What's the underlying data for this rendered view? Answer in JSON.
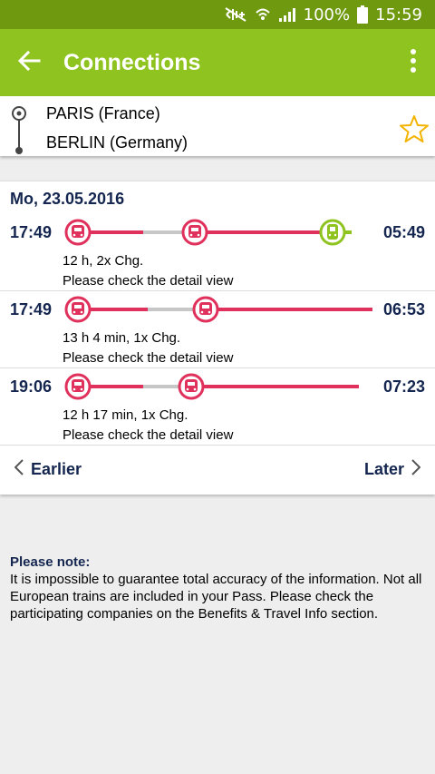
{
  "status_bar": {
    "battery": "100%",
    "time": "15:59"
  },
  "app_bar": {
    "title": "Connections"
  },
  "route": {
    "from": "PARIS (France)",
    "to": "BERLIN (Germany)"
  },
  "date": "Mo, 23.05.2016",
  "connections": [
    {
      "departure": "17:49",
      "arrival": "05:49",
      "summary": "12 h, 2x Chg.",
      "hint": "Please check the detail view",
      "legs": [
        {
          "type": "train",
          "color": "#e0315c"
        },
        {
          "type": "transfer",
          "color": "#c7c7c7"
        },
        {
          "type": "train",
          "color": "#e0315c"
        },
        {
          "type": "train",
          "color": "#8fc31f"
        }
      ]
    },
    {
      "departure": "17:49",
      "arrival": "06:53",
      "summary": "13 h 4 min, 1x Chg.",
      "hint": "Please check the detail view",
      "legs": [
        {
          "type": "train",
          "color": "#e0315c"
        },
        {
          "type": "transfer",
          "color": "#c7c7c7"
        },
        {
          "type": "train",
          "color": "#e0315c"
        }
      ]
    },
    {
      "departure": "19:06",
      "arrival": "07:23",
      "summary": "12 h 17 min, 1x Chg.",
      "hint": "Please check the detail view",
      "legs": [
        {
          "type": "train",
          "color": "#e0315c"
        },
        {
          "type": "transfer",
          "color": "#c7c7c7"
        },
        {
          "type": "train",
          "color": "#e0315c"
        }
      ]
    }
  ],
  "pager": {
    "earlier": "Earlier",
    "later": "Later"
  },
  "note": {
    "title": "Please note:",
    "text": "It is impossible to guarantee total accuracy of the information. Not all European trains are included in your Pass. Please check the participating companies on the Benefits & Travel Info section."
  },
  "colors": {
    "status_bar": "#6f9a10",
    "app_bar": "#8fc31f",
    "accent_text": "#14264f",
    "train_red": "#e0315c",
    "train_green": "#8fc31f",
    "transfer_gray": "#c7c7c7",
    "star": "#f2b400"
  },
  "icons": [
    "mute-icon",
    "wifi-icon",
    "signal-icon",
    "battery-icon",
    "back-arrow-icon",
    "more-vert-icon",
    "location-pin-icon",
    "star-outline-icon",
    "train-icon",
    "chevron-left-icon",
    "chevron-right-icon"
  ]
}
